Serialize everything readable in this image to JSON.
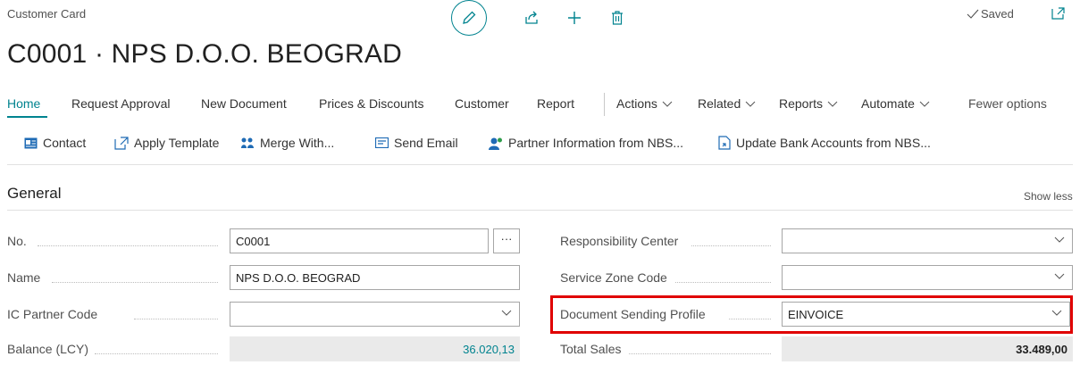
{
  "header": {
    "page_caption": "Customer Card",
    "title": "C0001 · NPS D.O.O. BEOGRAD",
    "saved_label": "Saved"
  },
  "menu": {
    "home": "Home",
    "request_approval": "Request Approval",
    "new_document": "New Document",
    "prices_discounts": "Prices & Discounts",
    "customer": "Customer",
    "report": "Report",
    "actions": "Actions",
    "related": "Related",
    "reports": "Reports",
    "automate": "Automate",
    "fewer_options": "Fewer options"
  },
  "actionbar": {
    "contact": "Contact",
    "apply_template": "Apply Template",
    "merge_with": "Merge With...",
    "send_email": "Send Email",
    "partner_info": "Partner Information from NBS...",
    "update_bank": "Update Bank Accounts from NBS..."
  },
  "section": {
    "title": "General",
    "show_less": "Show less"
  },
  "fields": {
    "no_label": "No.",
    "no_value": "C0001",
    "name_label": "Name",
    "name_value": "NPS D.O.O. BEOGRAD",
    "ic_partner_label": "IC Partner Code",
    "ic_partner_value": "",
    "balance_label": "Balance (LCY)",
    "balance_value": "36.020,13",
    "resp_center_label": "Responsibility Center",
    "resp_center_value": "",
    "service_zone_label": "Service Zone Code",
    "service_zone_value": "",
    "doc_sending_label": "Document Sending Profile",
    "doc_sending_value": "EINVOICE",
    "total_sales_label": "Total Sales",
    "total_sales_value": "33.489,00",
    "ellipsis": "···"
  },
  "colors": {
    "accent": "#00838f",
    "highlight": "#e00000"
  },
  "icons": [
    "edit-icon",
    "share-icon",
    "plus-icon",
    "delete-icon",
    "checkmark-icon",
    "open-new-window-icon",
    "chevron-down-icon",
    "contact-icon",
    "apply-template-icon",
    "merge-icon",
    "email-icon",
    "partner-info-icon",
    "update-bank-icon"
  ]
}
